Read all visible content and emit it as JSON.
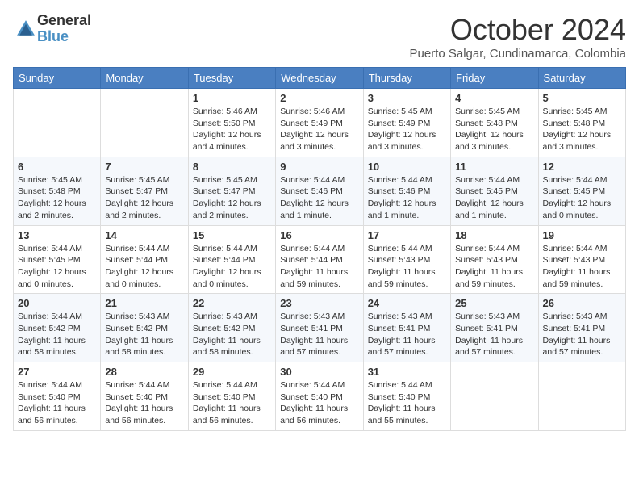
{
  "header": {
    "logo": {
      "general": "General",
      "blue": "Blue"
    },
    "title": "October 2024",
    "location": "Puerto Salgar, Cundinamarca, Colombia"
  },
  "days_of_week": [
    "Sunday",
    "Monday",
    "Tuesday",
    "Wednesday",
    "Thursday",
    "Friday",
    "Saturday"
  ],
  "weeks": [
    [
      {
        "day": "",
        "info": ""
      },
      {
        "day": "",
        "info": ""
      },
      {
        "day": "1",
        "info": "Sunrise: 5:46 AM\nSunset: 5:50 PM\nDaylight: 12 hours and 4 minutes."
      },
      {
        "day": "2",
        "info": "Sunrise: 5:46 AM\nSunset: 5:49 PM\nDaylight: 12 hours and 3 minutes."
      },
      {
        "day": "3",
        "info": "Sunrise: 5:45 AM\nSunset: 5:49 PM\nDaylight: 12 hours and 3 minutes."
      },
      {
        "day": "4",
        "info": "Sunrise: 5:45 AM\nSunset: 5:48 PM\nDaylight: 12 hours and 3 minutes."
      },
      {
        "day": "5",
        "info": "Sunrise: 5:45 AM\nSunset: 5:48 PM\nDaylight: 12 hours and 3 minutes."
      }
    ],
    [
      {
        "day": "6",
        "info": "Sunrise: 5:45 AM\nSunset: 5:48 PM\nDaylight: 12 hours and 2 minutes."
      },
      {
        "day": "7",
        "info": "Sunrise: 5:45 AM\nSunset: 5:47 PM\nDaylight: 12 hours and 2 minutes."
      },
      {
        "day": "8",
        "info": "Sunrise: 5:45 AM\nSunset: 5:47 PM\nDaylight: 12 hours and 2 minutes."
      },
      {
        "day": "9",
        "info": "Sunrise: 5:44 AM\nSunset: 5:46 PM\nDaylight: 12 hours and 1 minute."
      },
      {
        "day": "10",
        "info": "Sunrise: 5:44 AM\nSunset: 5:46 PM\nDaylight: 12 hours and 1 minute."
      },
      {
        "day": "11",
        "info": "Sunrise: 5:44 AM\nSunset: 5:45 PM\nDaylight: 12 hours and 1 minute."
      },
      {
        "day": "12",
        "info": "Sunrise: 5:44 AM\nSunset: 5:45 PM\nDaylight: 12 hours and 0 minutes."
      }
    ],
    [
      {
        "day": "13",
        "info": "Sunrise: 5:44 AM\nSunset: 5:45 PM\nDaylight: 12 hours and 0 minutes."
      },
      {
        "day": "14",
        "info": "Sunrise: 5:44 AM\nSunset: 5:44 PM\nDaylight: 12 hours and 0 minutes."
      },
      {
        "day": "15",
        "info": "Sunrise: 5:44 AM\nSunset: 5:44 PM\nDaylight: 12 hours and 0 minutes."
      },
      {
        "day": "16",
        "info": "Sunrise: 5:44 AM\nSunset: 5:44 PM\nDaylight: 11 hours and 59 minutes."
      },
      {
        "day": "17",
        "info": "Sunrise: 5:44 AM\nSunset: 5:43 PM\nDaylight: 11 hours and 59 minutes."
      },
      {
        "day": "18",
        "info": "Sunrise: 5:44 AM\nSunset: 5:43 PM\nDaylight: 11 hours and 59 minutes."
      },
      {
        "day": "19",
        "info": "Sunrise: 5:44 AM\nSunset: 5:43 PM\nDaylight: 11 hours and 59 minutes."
      }
    ],
    [
      {
        "day": "20",
        "info": "Sunrise: 5:44 AM\nSunset: 5:42 PM\nDaylight: 11 hours and 58 minutes."
      },
      {
        "day": "21",
        "info": "Sunrise: 5:43 AM\nSunset: 5:42 PM\nDaylight: 11 hours and 58 minutes."
      },
      {
        "day": "22",
        "info": "Sunrise: 5:43 AM\nSunset: 5:42 PM\nDaylight: 11 hours and 58 minutes."
      },
      {
        "day": "23",
        "info": "Sunrise: 5:43 AM\nSunset: 5:41 PM\nDaylight: 11 hours and 57 minutes."
      },
      {
        "day": "24",
        "info": "Sunrise: 5:43 AM\nSunset: 5:41 PM\nDaylight: 11 hours and 57 minutes."
      },
      {
        "day": "25",
        "info": "Sunrise: 5:43 AM\nSunset: 5:41 PM\nDaylight: 11 hours and 57 minutes."
      },
      {
        "day": "26",
        "info": "Sunrise: 5:43 AM\nSunset: 5:41 PM\nDaylight: 11 hours and 57 minutes."
      }
    ],
    [
      {
        "day": "27",
        "info": "Sunrise: 5:44 AM\nSunset: 5:40 PM\nDaylight: 11 hours and 56 minutes."
      },
      {
        "day": "28",
        "info": "Sunrise: 5:44 AM\nSunset: 5:40 PM\nDaylight: 11 hours and 56 minutes."
      },
      {
        "day": "29",
        "info": "Sunrise: 5:44 AM\nSunset: 5:40 PM\nDaylight: 11 hours and 56 minutes."
      },
      {
        "day": "30",
        "info": "Sunrise: 5:44 AM\nSunset: 5:40 PM\nDaylight: 11 hours and 56 minutes."
      },
      {
        "day": "31",
        "info": "Sunrise: 5:44 AM\nSunset: 5:40 PM\nDaylight: 11 hours and 55 minutes."
      },
      {
        "day": "",
        "info": ""
      },
      {
        "day": "",
        "info": ""
      }
    ]
  ]
}
